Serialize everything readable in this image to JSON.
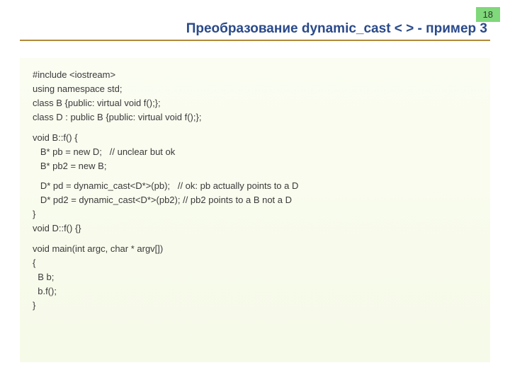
{
  "page_number": "18",
  "title": "Преобразование dynamic_cast < > - пример 3",
  "code": {
    "l1": "#include <iostream>",
    "l2": "using namespace std;",
    "l3": "class B {public: virtual void f();};",
    "l4": "class D : public B {public: virtual void f();};",
    "l5": "void B::f() {",
    "l6": "   B* pb = new D;   // unclear but ok",
    "l7": "   B* pb2 = new B;",
    "l8": "   D* pd = dynamic_cast<D*>(pb);   // ok: pb actually points to a D",
    "l9": "   D* pd2 = dynamic_cast<D*>(pb2); // pb2 points to a B not a D",
    "l10": "}",
    "l11": "void D::f() {}",
    "l12": "void main(int argc, char * argv[])",
    "l13": "{",
    "l14": "  B b;",
    "l15": "  b.f();",
    "l16": "}"
  }
}
